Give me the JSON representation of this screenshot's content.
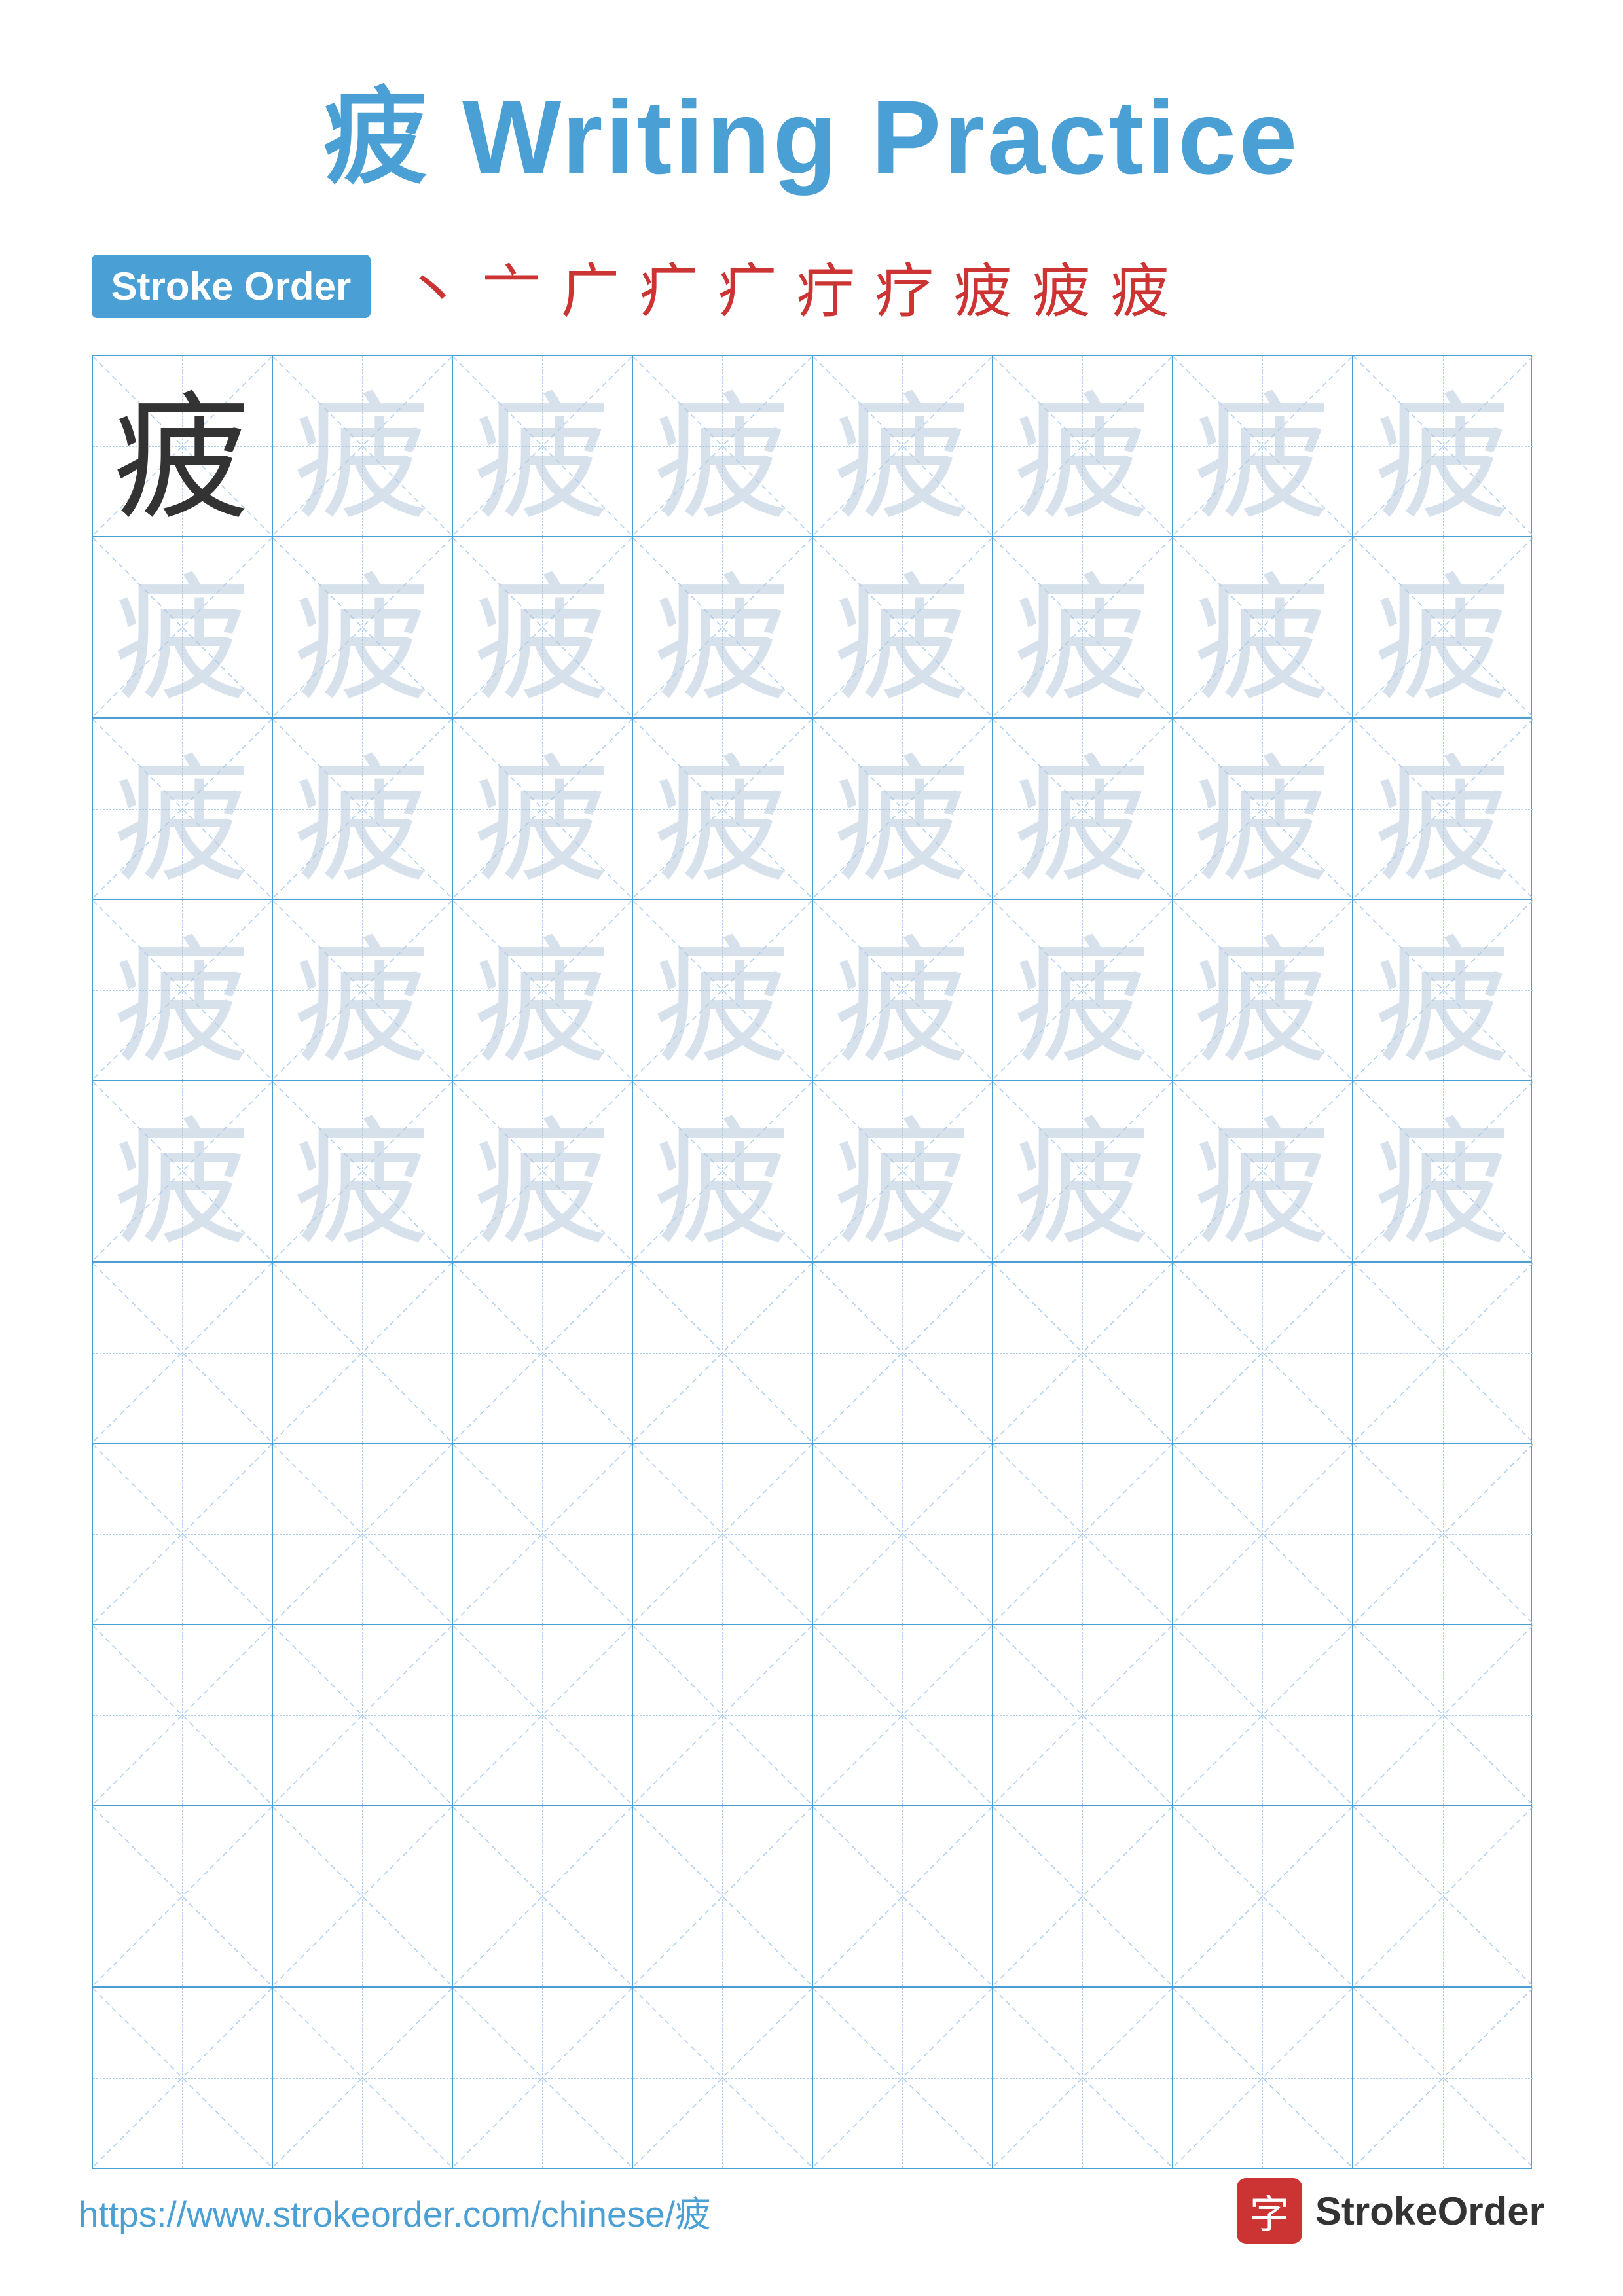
{
  "title": {
    "chinese": "疲",
    "english": " Writing Practice"
  },
  "stroke_order": {
    "badge_label": "Stroke Order",
    "strokes": [
      "丶",
      "亠",
      "广",
      "疒",
      "疒",
      "疲",
      "疲",
      "疲",
      "疲",
      "疲"
    ]
  },
  "grid": {
    "rows": 10,
    "cols": 8,
    "faded_rows": 5,
    "empty_rows": 5,
    "character": "疲"
  },
  "footer": {
    "url": "https://www.strokeorder.com/chinese/疲",
    "brand": "StrokeOrder",
    "logo_char": "字"
  }
}
